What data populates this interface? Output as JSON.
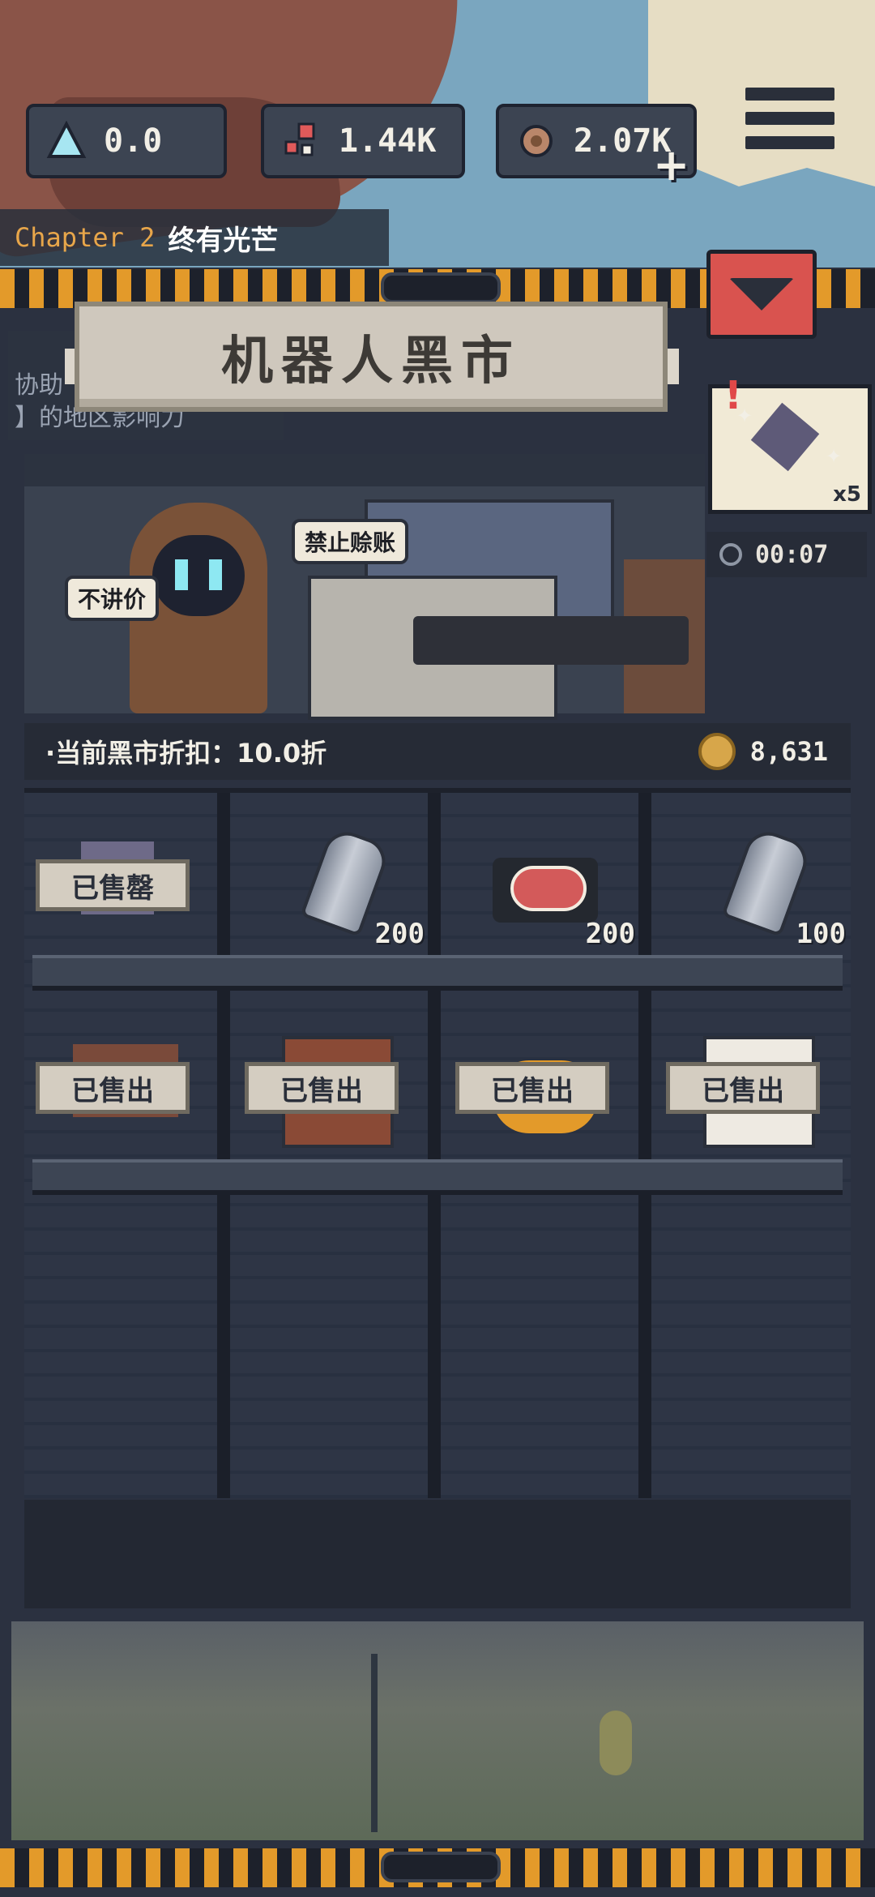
{
  "top_bar": {
    "resources": [
      {
        "icon": "crystal-icon",
        "value": "0.0"
      },
      {
        "icon": "parts-icon",
        "value": "1.44K"
      },
      {
        "icon": "meat-icon",
        "value": "2.07K"
      }
    ],
    "add_symbol": "+"
  },
  "chapter": {
    "label": "Chapter 2",
    "title": "终有光芒"
  },
  "header": {
    "title": "机器人黑市",
    "hint_lines": [
      "协助",
      "】的地区影响力"
    ]
  },
  "side_card": {
    "count": "x5",
    "alert": "!",
    "timer": "00:07"
  },
  "scene": {
    "bubble_left": "不讲价",
    "bubble_right": "禁止赊账"
  },
  "market": {
    "discount_label": "·当前黑市折扣：10.0折",
    "coins": "8,631"
  },
  "shelf": {
    "row1": [
      {
        "item": "gem-card",
        "status": "已售罄",
        "price": ""
      },
      {
        "item": "metal-can",
        "status": "",
        "price": "200"
      },
      {
        "item": "steak",
        "status": "",
        "price": "200"
      },
      {
        "item": "metal-can",
        "status": "",
        "price": "100"
      }
    ],
    "row2": [
      {
        "item": "sign-board",
        "status": "已售出"
      },
      {
        "item": "book",
        "status": "已售出"
      },
      {
        "item": "roast-meat",
        "status": "已售出"
      },
      {
        "item": "shirt",
        "status": "已售出"
      }
    ]
  },
  "colors": {
    "hazard_orange": "#e39a2a",
    "alert_red": "#d9534f",
    "panel_dark": "#2b3140"
  }
}
